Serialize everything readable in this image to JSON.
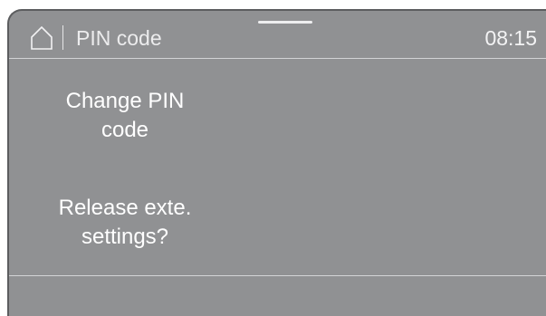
{
  "header": {
    "title": "PIN code",
    "time": "08:15",
    "home_icon": "home-icon"
  },
  "menu": {
    "items": [
      {
        "label_line1": "Change PIN",
        "label_line2": "code"
      },
      {
        "label_line1": "Release exte.",
        "label_line2": "settings?"
      }
    ]
  },
  "colors": {
    "screen_background": "#909193",
    "text": "#ffffff",
    "frame": "#5c5d5f"
  }
}
